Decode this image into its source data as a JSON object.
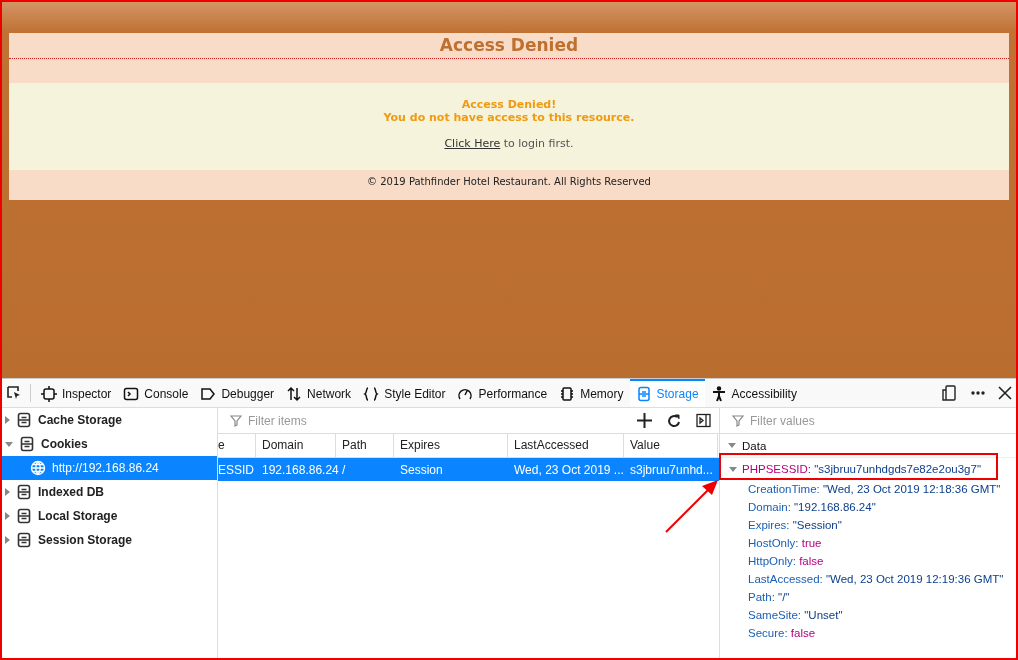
{
  "page": {
    "title": "Access Denied",
    "message_lines": [
      "Access Denied!",
      "You do not have access to this resource."
    ],
    "link": "Click Here",
    "link_suffix": " to login first.",
    "footer": "© 2019 Pathfinder Hotel Restaurant. All Rights Reserved"
  },
  "devtools": {
    "tabs": [
      {
        "label": "Inspector",
        "selected": false
      },
      {
        "label": "Console",
        "selected": false
      },
      {
        "label": "Debugger",
        "selected": false
      },
      {
        "label": "Network",
        "selected": false
      },
      {
        "label": "Style Editor",
        "selected": false
      },
      {
        "label": "Performance",
        "selected": false
      },
      {
        "label": "Memory",
        "selected": false
      },
      {
        "label": "Storage",
        "selected": true
      },
      {
        "label": "Accessibility",
        "selected": false
      }
    ],
    "sidebar": [
      {
        "label": "Cache Storage",
        "expanded": false,
        "selected": false
      },
      {
        "label": "Cookies",
        "expanded": true,
        "selected": false,
        "children": [
          {
            "label": "http://192.168.86.24",
            "selected": true
          }
        ]
      },
      {
        "label": "Indexed DB",
        "expanded": false,
        "selected": false
      },
      {
        "label": "Local Storage",
        "expanded": false,
        "selected": false
      },
      {
        "label": "Session Storage",
        "expanded": false,
        "selected": false
      }
    ],
    "filter_items": {
      "placeholder": "Filter items"
    },
    "table": {
      "columns": [
        "e",
        "Domain",
        "Path",
        "Expires",
        "LastAccessed",
        "Value"
      ],
      "rows": [
        {
          "selected": true,
          "cells": [
            "ESSID",
            "192.168.86.24",
            "/",
            "Session",
            "Wed, 23 Oct 2019 ...",
            "s3jbruu7unhd..."
          ]
        }
      ]
    },
    "filter_values": {
      "placeholder": "Filter values"
    },
    "details": {
      "section": "Data",
      "expanded": true,
      "cookie": {
        "name": "PHPSESSID",
        "value": ": \"s3jbruu7unhdgds7e82e2ou3g7\"",
        "expanded": true
      },
      "properties": [
        {
          "name": "CreationTime:",
          "value": "\"Wed, 23 Oct 2019 12:18:36 GMT\"",
          "kind": "string"
        },
        {
          "name": "Domain:",
          "value": "\"192.168.86.24\"",
          "kind": "string"
        },
        {
          "name": "Expires:",
          "value": "\"Session\"",
          "kind": "string"
        },
        {
          "name": "HostOnly:",
          "value": "true",
          "kind": "boolean"
        },
        {
          "name": "HttpOnly:",
          "value": "false",
          "kind": "boolean"
        },
        {
          "name": "LastAccessed:",
          "value": "\"Wed, 23 Oct 2019 12:19:36 GMT\"",
          "kind": "string"
        },
        {
          "name": "Path:",
          "value": "\"/\"",
          "kind": "string"
        },
        {
          "name": "SameSite:",
          "value": "\"Unset\"",
          "kind": "string"
        },
        {
          "name": "Secure:",
          "value": "false",
          "kind": "boolean"
        }
      ]
    }
  }
}
